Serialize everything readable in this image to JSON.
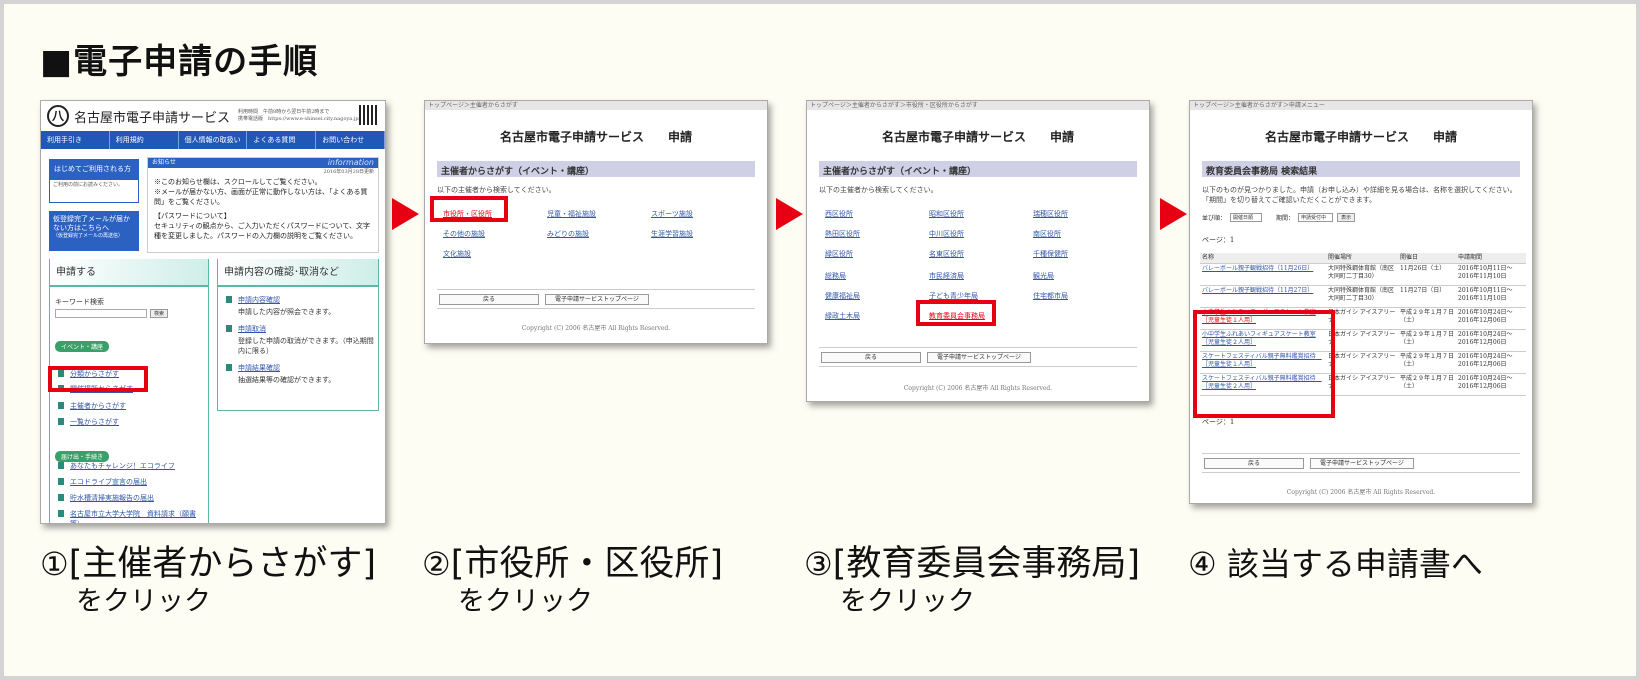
{
  "page_title": "■電子申請の手順",
  "common": {
    "site_title": "名古屋市電子申請サービス",
    "shinsei": "申請",
    "back": "戻る",
    "top_btn": "電子申請サービストップページ",
    "copyright": "Copyright (C) 2006 名古屋市 All Rights Reserved.",
    "instruction": "以下の主催者から検索してください。",
    "section_organizer": "主催者からさがす（イベント・講座）"
  },
  "shot1": {
    "logo": "八",
    "site_name": "名古屋市電子申請サービス",
    "hours": "利用時間　午前8時から翌日午前2時まで",
    "mobile": "携帯電話版　https://www.e-shinsei.city.nagoya.jp/m/",
    "nav": [
      "利用手引き",
      "利用規約",
      "個人情報の取扱い",
      "よくある質問",
      "お問い合わせ"
    ],
    "first_time": "はじめてご利用される方",
    "first_time_sub": "ご利用の前にお読みください。",
    "no_mail": "仮登録完了メールが届かない方はこちらへ",
    "no_mail_sub": "（仮登録完了メールの再送信）",
    "notice_label": "お知らせ",
    "info_label": "information",
    "notice_date": "2016年03月28日更新",
    "notice_lines": [
      "※このお知らせ欄は、スクロールしてご覧ください。",
      "※メールが届かない方、画面が正常に動作しない方は、「よくある質問」をご覧ください。",
      "【パスワードについて】",
      "セキュリティの観点から、ご入力いただくパスワードについて、文字種を変更しました。パスワードの入力欄の説明をご覧ください。"
    ],
    "apply_title": "申請する",
    "keyword_label": "キーワード検索",
    "search_btn": "検索",
    "event_pill": "イベント・講座",
    "event_links": [
      "分類からさがす",
      "開催場所からさがす",
      "主催者からさがす",
      "一覧からさがす"
    ],
    "todoke_pill": "届け出・手続き",
    "todoke_links": [
      "あなたもチャレンジ！エコライフ",
      "エコドライブ宣言の届出",
      "貯水槽清掃実施報告の届出",
      "名古屋市立大学大学院　資料請求（願書等）"
    ],
    "confirm_title": "申請内容の確認･取消など",
    "confirm_items": [
      {
        "link": "申請内容確認",
        "desc": "申請した内容が照会できます。"
      },
      {
        "link": "申請取消",
        "desc": "登録した申請の取消ができます。（申込期間内に限る）"
      },
      {
        "link": "申請結果確認",
        "desc": "抽選結果等の確認ができます。"
      }
    ]
  },
  "shot2": {
    "breadcrumb": "トップページ＞主催者からさがす",
    "links": [
      "市役所・区役所",
      "児童・福祉施設",
      "スポーツ施設",
      "その他の施設",
      "みどりの施設",
      "生涯学習施設",
      "文化施設"
    ]
  },
  "shot3": {
    "breadcrumb": "トップページ＞主催者からさがす＞市役所・区役所からさがす",
    "links": [
      "西区役所",
      "昭和区役所",
      "瑞穂区役所",
      "熱田区役所",
      "中川区役所",
      "南区役所",
      "緑区役所",
      "名東区役所",
      "千種保健所",
      "総務局",
      "市民経済局",
      "観光局",
      "健康福祉局",
      "子ども青少年局",
      "住宅都市局",
      "緑政土木局",
      "教育委員会事務局"
    ]
  },
  "shot4": {
    "breadcrumb": "トップページ＞主催者からさがす＞申請メニュー",
    "section": "教育委員会事務局 検索結果",
    "desc": "以下のものが見つかりました。申請（お申し込み）や詳細を見る場合は、名称を選択してください。「期間」を切り替えてご確認いただくことができます。",
    "sort_label": "並び順：",
    "sort_value": "開催日順",
    "period_label": "期間：",
    "period_value": "申請受付中",
    "show_btn": "表示",
    "page_label": "ページ：1",
    "headers": [
      "名称",
      "開催場所",
      "開催日",
      "申請期間"
    ],
    "rows": [
      {
        "name": "バレーボール親子観戦招待（11月26日）",
        "place": "大同特殊鋼体育館（南区大同町二丁目30）",
        "date": "11月26日（土）",
        "period": "2016年10月11日～2016年11月10日"
      },
      {
        "name": "バレーボール親子観戦招待（11月27日）",
        "place": "大同特殊鋼体育館（南区大同町二丁目30）",
        "date": "11月27日（日）",
        "period": "2016年10月11日～2016年11月10日"
      },
      {
        "name": "小中学生ふれあいフィギュアスケート教室［児童生徒１人用］",
        "place": "日本ガイシ アイスアリーナ",
        "date": "平成２９年１月７日（土）",
        "period": "2016年10月24日～2016年12月06日"
      },
      {
        "name": "小中学生ふれあいフィギュアスケート教室［児童生徒２人用］",
        "place": "日本ガイシ アイスアリーナ",
        "date": "平成２９年１月７日（土）",
        "period": "2016年10月24日～2016年12月06日"
      },
      {
        "name": "スケートフェスティバル親子無料鑑賞招待　［児童生徒１人用］",
        "place": "日本ガイシ アイスアリーナ",
        "date": "平成２９年１月７日（土）",
        "period": "2016年10月24日～2016年12月06日"
      },
      {
        "name": "スケートフェスティバル親子無料鑑賞招待　［児童生徒２人用］",
        "place": "日本ガイシ アイスアリーナ",
        "date": "平成２９年１月７日（土）",
        "period": "2016年10月24日～2016年12月06日"
      }
    ]
  },
  "captions": [
    {
      "num": "①",
      "main": "[主催者からさがす]",
      "sub": "をクリック"
    },
    {
      "num": "②",
      "main": "[市役所・区役所]",
      "sub": "をクリック"
    },
    {
      "num": "③",
      "main": "[教育委員会事務局]",
      "sub": "をクリック"
    },
    {
      "num": "④",
      "main": "該当する申請書へ",
      "sub": ""
    }
  ]
}
